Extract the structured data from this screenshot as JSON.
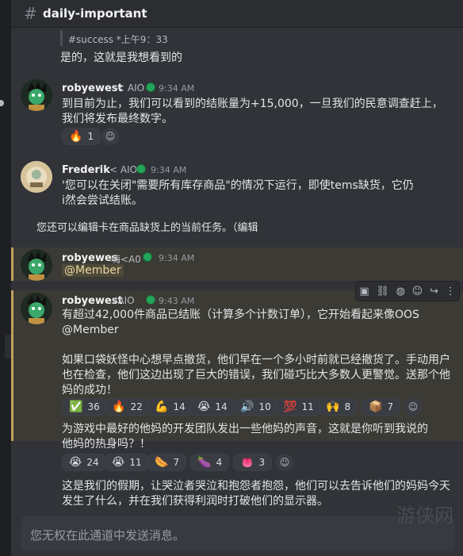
{
  "channel": {
    "name": "daily-important"
  },
  "reply_preview": "#success *上午9：33",
  "messages": [
    {
      "text": "是的，这就是我想看到的"
    },
    {
      "username": "robyewest",
      "tag": "< AIO",
      "time": "9:34 AM",
      "lines": [
        "到目前为止，我们可以看到的结账量为+15,000，一旦我们的民意调查赶上，",
        "我们将发布最终数字。"
      ],
      "reactions": [
        {
          "emoji": "🔥",
          "count": "1"
        }
      ]
    },
    {
      "username": "Frederik",
      "tag": "< AIO",
      "time": "9:34 AM",
      "lines": [
        "'您可以在关闭\"需要所有库存商品\"的情况下运行，即使tems缺货，它仍",
        "i然会尝试结账。"
      ]
    },
    {
      "text": "您还可以编辑卡在商品缺货上的当前任务。（编辑"
    },
    {
      "username": "robyewes",
      "tag": "嗨<A0",
      "time": "9:34 AM",
      "mention": "@Member"
    },
    {
      "username": "robyewest",
      "tag": "⚡AIO",
      "time": "9:43 AM",
      "lines": [
        "有超过42,000件商品已结账（计算多个计数订单），它开始看起来像OOS",
        "@Member"
      ],
      "paragraph2": [
        "如果口袋妖怪中心想早点撤货，他们早在一个多小时前就已经撤货了。手动用户",
        "也在检查，他们这边出现了巨大的错误，我们碰巧比大多数人更警觉。送那个他",
        "妈的成功！"
      ],
      "reactions": [
        {
          "emoji": "✅",
          "count": "36"
        },
        {
          "emoji": "🔥",
          "count": "22"
        },
        {
          "emoji": "💪",
          "count": "14"
        },
        {
          "emoji": "😭",
          "count": "14"
        },
        {
          "emoji": "🔊",
          "count": "10"
        },
        {
          "emoji": "💯",
          "count": "11"
        },
        {
          "emoji": "🙌",
          "count": "8"
        },
        {
          "emoji": "📦",
          "count": "7"
        }
      ]
    },
    {
      "lines": [
        "为游戏中最好的他妈的开发团队发出一些他妈的声音，这就是你听到我说的",
        "他妈的热身吗？！"
      ],
      "reactions": [
        {
          "emoji": "😭",
          "count": "24"
        },
        {
          "emoji": "😭",
          "count": "11"
        },
        {
          "emoji": "🌭",
          "count": "7"
        },
        {
          "emoji": "🍆",
          "count": "4"
        },
        {
          "emoji": "👅",
          "count": "3"
        }
      ]
    },
    {
      "lines": [
        "这是我们的假期，让哭泣者哭泣和抱怨者抱怨，他们可以去告诉他们的妈妈今天",
        "发生了什么，并在我们获得利润时打破他们的显示器。"
      ]
    }
  ],
  "composer": {
    "placeholder": "您无权在此通道中发送消息。"
  },
  "watermark": "游侠网",
  "colors": {
    "background": "#313338",
    "status_online": "#23a55a",
    "highlight": "#c0a060"
  },
  "icons": [
    "hash-icon",
    "add-reaction-icon",
    "apps-icon",
    "link-icon",
    "reply-icon",
    "more-icon"
  ]
}
